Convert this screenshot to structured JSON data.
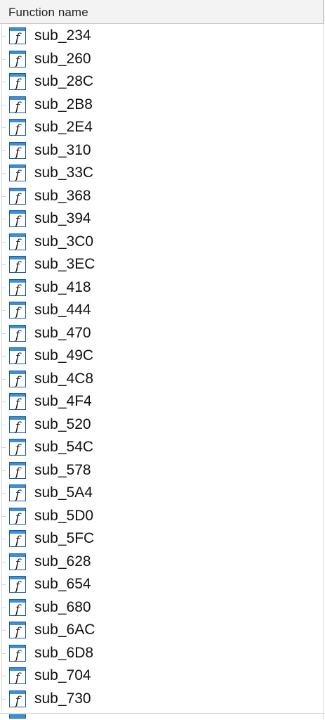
{
  "header": {
    "column_title": "Function name"
  },
  "icon": {
    "name": "function-icon",
    "glyph": "f",
    "colors": {
      "frame": "#1d5a96",
      "titlebar": "#3d8fd6",
      "body": "#ffffff",
      "glyph": "#1a1a1a"
    }
  },
  "functions": [
    "sub_234",
    "sub_260",
    "sub_28C",
    "sub_2B8",
    "sub_2E4",
    "sub_310",
    "sub_33C",
    "sub_368",
    "sub_394",
    "sub_3C0",
    "sub_3EC",
    "sub_418",
    "sub_444",
    "sub_470",
    "sub_49C",
    "sub_4C8",
    "sub_4F4",
    "sub_520",
    "sub_54C",
    "sub_578",
    "sub_5A4",
    "sub_5D0",
    "sub_5FC",
    "sub_628",
    "sub_654",
    "sub_680",
    "sub_6AC",
    "sub_6D8",
    "sub_704",
    "sub_730"
  ]
}
